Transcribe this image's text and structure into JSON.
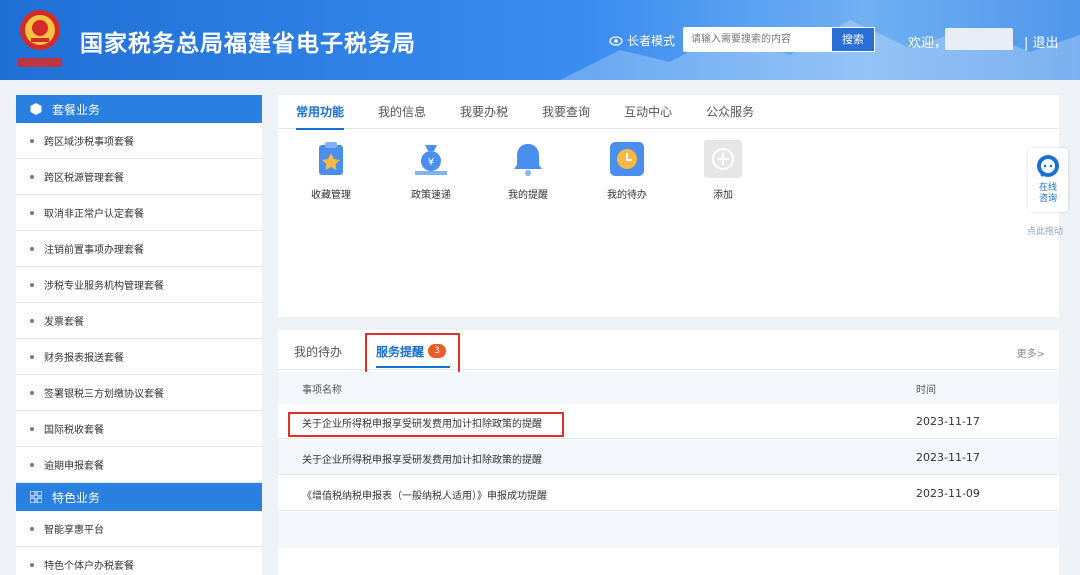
{
  "header": {
    "site_title": "国家税务总局福建省电子税务局",
    "logo_caption": "中国税务",
    "elder_mode": "长者模式",
    "search_placeholder": "请输入需要搜索的内容",
    "search_button": "搜索",
    "welcome": "欢迎，",
    "logout": "| 退出"
  },
  "sidebar": {
    "package_title": "套餐业务",
    "packages": [
      "跨区域涉税事项套餐",
      "跨区税源管理套餐",
      "取消非正常户认定套餐",
      "注销前置事项办理套餐",
      "涉税专业服务机构管理套餐",
      "发票套餐",
      "财务报表报送套餐",
      "签署银税三方划缴协议套餐",
      "国际税收套餐",
      "逾期申报套餐"
    ],
    "special_title": "特色业务",
    "specials": [
      "智能享惠平台",
      "特色个体户办税套餐"
    ]
  },
  "functions": {
    "tabs": [
      "常用功能",
      "我的信息",
      "我要办税",
      "我要查询",
      "互动中心",
      "公众服务"
    ],
    "items": [
      {
        "label": "收藏管理",
        "icon": "favorites-manage-icon"
      },
      {
        "label": "政策速递",
        "icon": "policy-express-icon"
      },
      {
        "label": "我的提醒",
        "icon": "bell-icon"
      },
      {
        "label": "我的待办",
        "icon": "todo-clock-icon"
      },
      {
        "label": "添加",
        "icon": "add-plus-icon"
      }
    ]
  },
  "reminders": {
    "tab_todo": "我的待办",
    "tab_service": "服务提醒",
    "badge_count": "3",
    "more": "更多>",
    "col_name": "事项名称",
    "col_time": "时间",
    "rows": [
      {
        "name": "关于企业所得税申报享受研发费用加计扣除政策的提醒",
        "time": "2023-11-17"
      },
      {
        "name": "关于企业所得税申报享受研发费用加计扣除政策的提醒",
        "time": "2023-11-17"
      },
      {
        "name": "《增值税纳税申报表（一般纳税人适用）》申报成功提醒",
        "time": "2023-11-09"
      }
    ]
  },
  "consult": {
    "line1": "在线",
    "line2": "咨询",
    "drag_tip": "点此拖动"
  },
  "colors": {
    "header_blue": "#1f6fd6",
    "accent": "#1a6fd6",
    "badge": "#f05a24",
    "highlight_red": "#e0302a"
  }
}
